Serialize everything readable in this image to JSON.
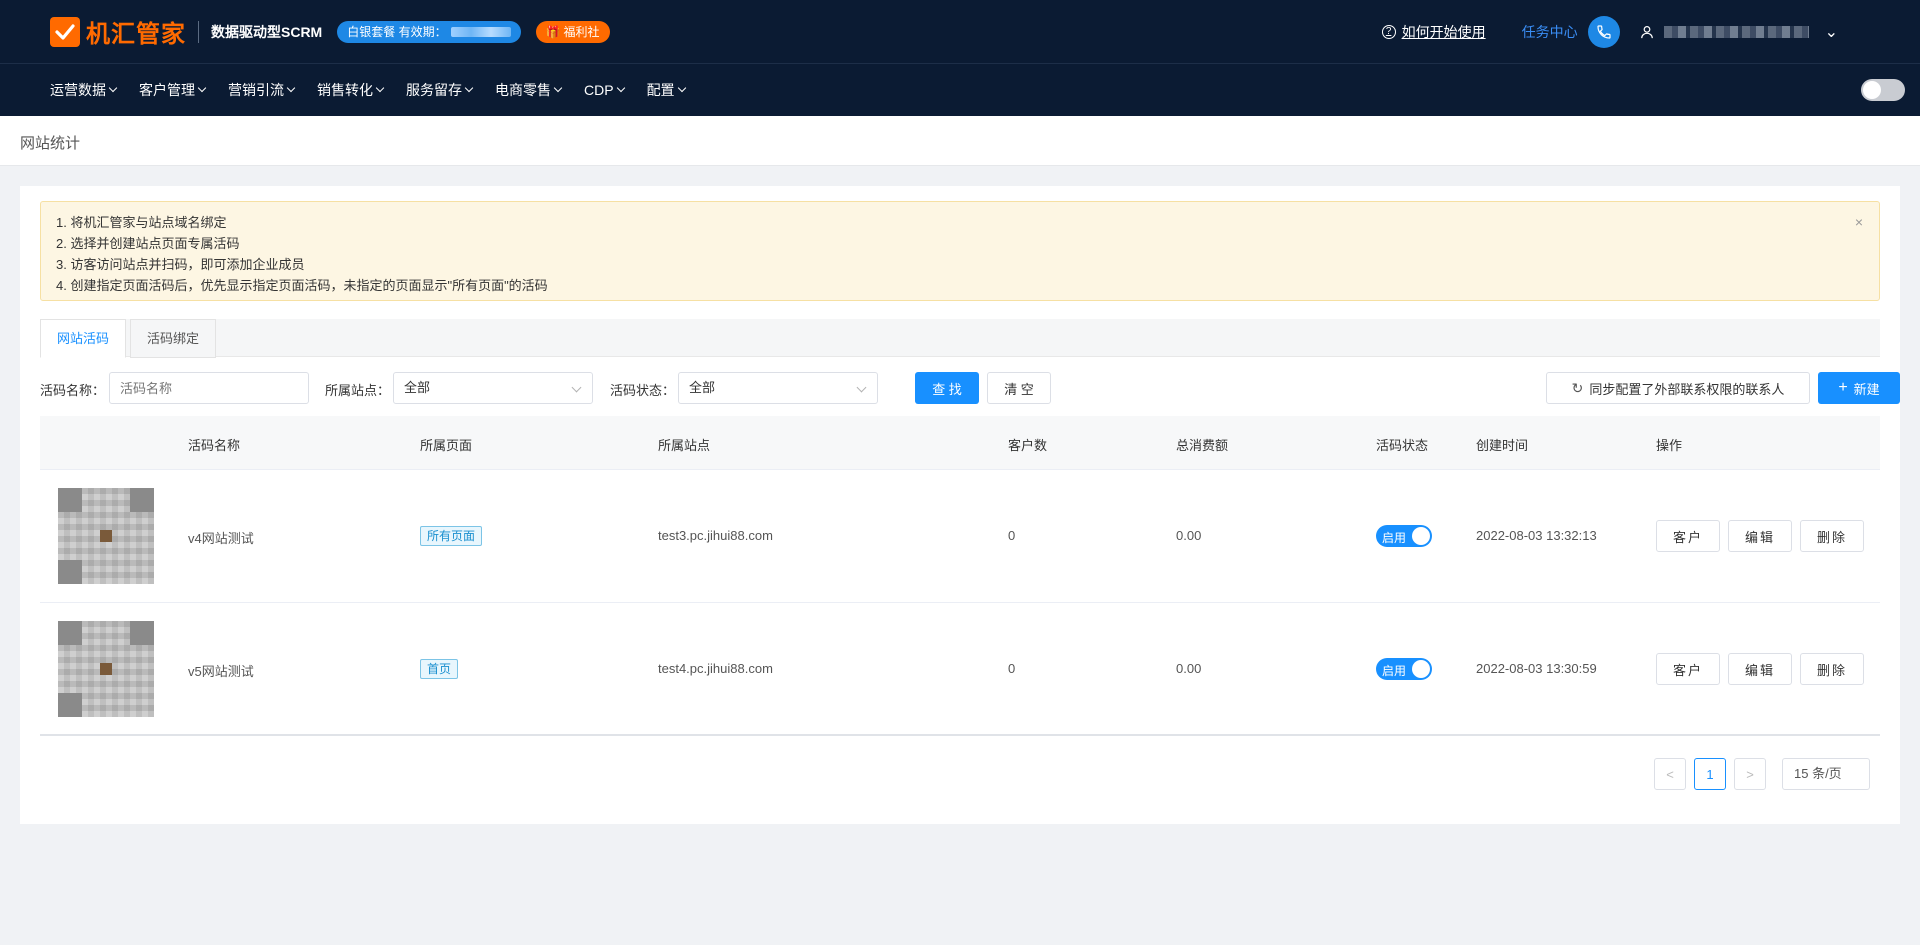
{
  "header": {
    "brand": "机汇管家",
    "slogan": "数据驱动型SCRM",
    "package_label": "白银套餐 有效期：",
    "welfare_label": "福利社",
    "help_label": "如何开始使用",
    "task_center_label": "任务中心"
  },
  "nav": {
    "items": [
      "运营数据",
      "客户管理",
      "营销引流",
      "销售转化",
      "服务留存",
      "电商零售",
      "CDP",
      "配置"
    ]
  },
  "page": {
    "title": "网站统计"
  },
  "notice": {
    "lines": [
      "1. 将机汇管家与站点域名绑定",
      "2. 选择并创建站点页面专属活码",
      "3. 访客访问站点并扫码，即可添加企业成员",
      "4. 创建指定页面活码后，优先显示指定页面活码，未指定的页面显示\"所有页面\"的活码"
    ],
    "close": "×"
  },
  "tabs": [
    "网站活码",
    "活码绑定"
  ],
  "filters": {
    "name_label": "活码名称：",
    "name_placeholder": "活码名称",
    "site_label": "所属站点：",
    "site_value": "全部",
    "status_label": "活码状态：",
    "status_value": "全部",
    "search_btn": "查 找",
    "clear_btn": "清 空",
    "sync_btn": "同步配置了外部联系权限的联系人",
    "new_btn": "新建"
  },
  "table": {
    "columns": [
      "活码名称",
      "所属页面",
      "所属站点",
      "客户数",
      "总消费额",
      "活码状态",
      "创建时间",
      "操作"
    ],
    "rows": [
      {
        "name": "v4网站测试",
        "page": "所有页面",
        "site": "test3.pc.jihui88.com",
        "customers": "0",
        "spend": "0.00",
        "status": "启用",
        "created": "2022-08-03 13:32:13",
        "actions": [
          "客户",
          "编辑",
          "删除"
        ]
      },
      {
        "name": "v5网站测试",
        "page": "首页",
        "site": "test4.pc.jihui88.com",
        "customers": "0",
        "spend": "0.00",
        "status": "启用",
        "created": "2022-08-03 13:30:59",
        "actions": [
          "客户",
          "编辑",
          "删除"
        ]
      }
    ]
  },
  "pagination": {
    "prev": "<",
    "current": "1",
    "next": ">",
    "page_size": "15 条/页"
  },
  "colors": {
    "header_bg": "#0b1b33",
    "brand_orange": "#ff6a00",
    "primary_blue": "#1890ff",
    "notice_bg": "#fdf6e3"
  }
}
